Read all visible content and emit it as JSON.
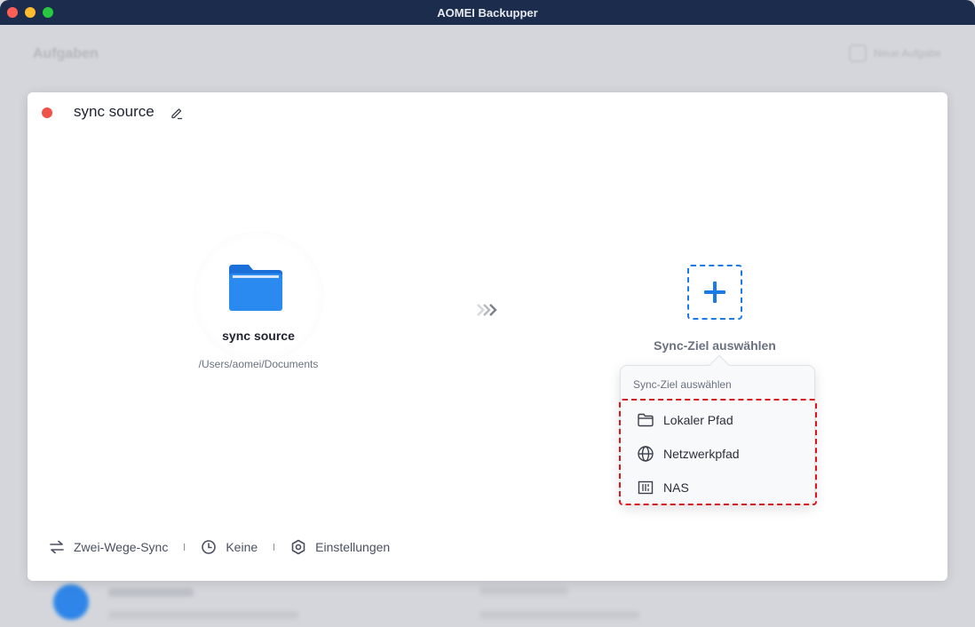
{
  "window": {
    "title": "AOMEI Backupper"
  },
  "background": {
    "heading": "Aufgaben",
    "new_task_label": "Neue Aufgabe"
  },
  "card": {
    "task_name": "sync source",
    "source": {
      "title": "sync source",
      "path": "/Users/aomei/Documents"
    },
    "target": {
      "label": "Sync-Ziel auswählen"
    },
    "bottom_bar": {
      "mode": "Zwei-Wege-Sync",
      "schedule": "Keine",
      "settings": "Einstellungen"
    }
  },
  "popover": {
    "title": "Sync-Ziel auswählen",
    "items": [
      {
        "label": "Lokaler Pfad",
        "icon": "folder-icon"
      },
      {
        "label": "Netzwerkpfad",
        "icon": "globe-icon"
      },
      {
        "label": "NAS",
        "icon": "nas-icon"
      }
    ]
  },
  "colors": {
    "accent": "#1a7ae8",
    "status_dot": "#f0524a",
    "highlight_border": "#d9151d",
    "titlebar": "#1c2c4c"
  }
}
